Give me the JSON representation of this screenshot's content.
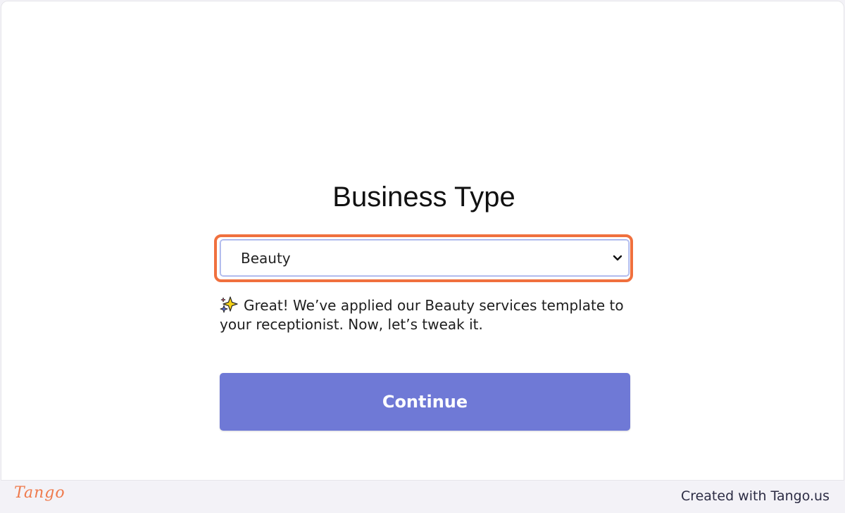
{
  "form": {
    "title": "Business Type",
    "select": {
      "selected_value": "Beauty",
      "icon": "chevron-down-icon"
    },
    "note": {
      "icon": "sparkles-icon",
      "text": "Great! We’ve applied our Beauty services template to your receptionist. Now, let’s tweak it."
    },
    "continue_label": "Continue"
  },
  "footer": {
    "logo_text": "Tango",
    "credit": "Created with Tango.us"
  },
  "colors": {
    "accent_button": "#6f79d6",
    "highlight_outline": "#f0703e",
    "brand": "#ef7a4c"
  }
}
